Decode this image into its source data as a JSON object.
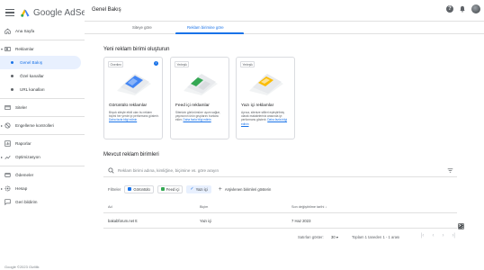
{
  "app": {
    "name": "Google AdSense",
    "page_title": "Genel Bakış"
  },
  "sidebar": {
    "items": [
      {
        "label": "Ana Sayfa"
      },
      {
        "label": "Reklamlar"
      },
      {
        "label": "Genel Bakış"
      },
      {
        "label": "Özel kanallar"
      },
      {
        "label": "URL kanalları"
      },
      {
        "label": "Siteler"
      },
      {
        "label": "Engelleme kontrolleri"
      },
      {
        "label": "Raporlar"
      },
      {
        "label": "Optimizasyon"
      },
      {
        "label": "Ödemeler"
      },
      {
        "label": "Hesap"
      },
      {
        "label": "Geri bildirim"
      }
    ],
    "footer": "Google ©2023 Gizlilik"
  },
  "tabs": [
    {
      "label": "Siteye göre"
    },
    {
      "label": "Reklam birimine göre"
    }
  ],
  "create_section": {
    "title": "Yeni reklam birimi oluşturun",
    "cards": [
      {
        "badge": "Önerilen",
        "title": "Görüntülü reklamlar",
        "desc": "Birçok siteyle etkili olan bu reklam biçimi her yerde iyi performans gösterir.",
        "link": "Daha fazla bilgi edinin"
      },
      {
        "badge": "Yerleşik",
        "title": "Feed içi reklamlar",
        "desc": "Sitenizin görünümüne uyum sağlar, yayıncının ürün gruplarını bunlara ekler.",
        "link": "Daha fazla bilgi edinin"
      },
      {
        "badge": "Yerleşik",
        "title": "Yazı içi reklamlar",
        "desc": "Ayrıca, sitenize stilleri eşleştirilmiş olarak makaleleriniz arasında iyi performans gösterir.",
        "link": "Daha fazla bilgi edinin"
      }
    ]
  },
  "existing_section": {
    "title": "Mevcut reklam birimleri",
    "search_placeholder": "Reklam birimi adına, kimliğine, biçimine vs. göre arayın",
    "filters_label": "Filtreler",
    "chips": [
      {
        "label": "Görüntülü",
        "color": "#1a73e8"
      },
      {
        "label": "Feed içi",
        "color": "#34a853"
      },
      {
        "label": "Yazı içi",
        "color": "#fbbc04"
      }
    ],
    "add_filter": "Arşivlenen birimleri gösterin",
    "table": {
      "headers": [
        "Ad",
        "Biçim",
        "Son değiştirilme tarihi"
      ],
      "rows": [
        {
          "name": "bakabforum.net tt",
          "type": "Yazı içi",
          "date": "7 Haz 2023"
        }
      ]
    },
    "pager": {
      "rows_label": "Satırları göster:",
      "rows_value": "30",
      "range": "Toplam 1 taneden 1 - 1 arası"
    }
  },
  "colors": {
    "accent": "#1a73e8",
    "active_bg": "#e8f0fe"
  }
}
